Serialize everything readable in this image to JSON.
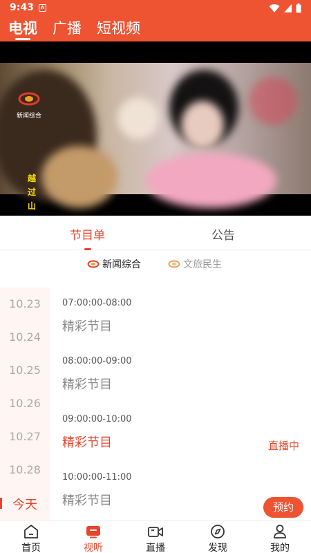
{
  "status_bar": {
    "time": "9:43",
    "notification_badge": "A"
  },
  "main_tabs": [
    {
      "label": "电视",
      "active": true
    },
    {
      "label": "广播",
      "active": false
    },
    {
      "label": "短视频",
      "active": false
    }
  ],
  "video": {
    "channel_logo_text": "新闻综合",
    "overlay_title": "越过山丘"
  },
  "sub_tabs": [
    {
      "label": "节目单",
      "active": true
    },
    {
      "label": "公告",
      "active": false
    }
  ],
  "channels": [
    {
      "name": "新闻综合",
      "active": true
    },
    {
      "name": "文旅民生",
      "active": false
    }
  ],
  "dates": [
    "10.23",
    "10.24",
    "10.25",
    "10.26",
    "10.27",
    "10.28",
    "今天"
  ],
  "active_date": "今天",
  "programs": [
    {
      "time": "07:00:00-08:00",
      "name": "精彩节目",
      "status": ""
    },
    {
      "time": "08:00:00-09:00",
      "name": "精彩节目",
      "status": ""
    },
    {
      "time": "09:00:00-10:00",
      "name": "精彩节目",
      "status": "直播中"
    },
    {
      "time": "10:00:00-11:00",
      "name": "精彩节目",
      "status": "预约"
    }
  ],
  "bottom_nav": [
    {
      "label": "首页",
      "icon": "home-icon",
      "active": false
    },
    {
      "label": "视听",
      "icon": "tv-icon",
      "active": true
    },
    {
      "label": "直播",
      "icon": "camera-icon",
      "active": false
    },
    {
      "label": "发现",
      "icon": "compass-icon",
      "active": false
    },
    {
      "label": "我的",
      "icon": "person-icon",
      "active": false
    }
  ],
  "colors": {
    "accent": "#ee5432",
    "active_text": "#e8442c",
    "date_bg": "#fff5f3",
    "overlay_title": "#ffe300"
  }
}
